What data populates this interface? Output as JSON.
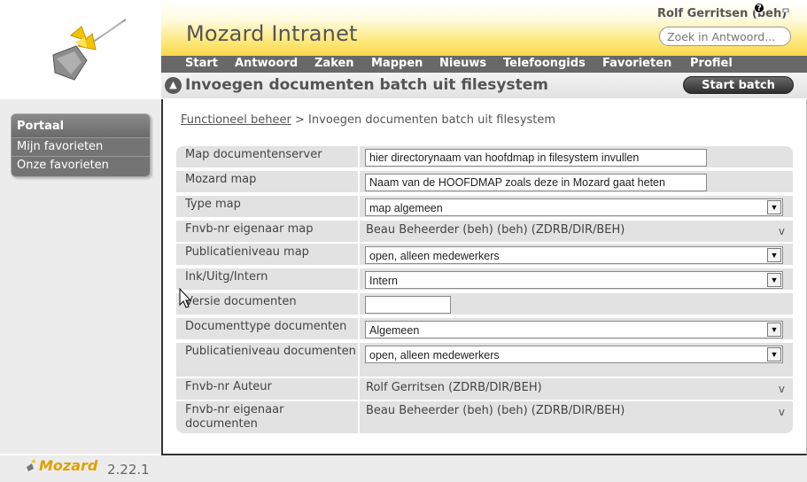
{
  "header": {
    "app_title": "Mozard Intranet",
    "user_name": "Rolf Gerritsen (beh)",
    "search_placeholder": "Zoek in Antwoord..."
  },
  "nav": {
    "items": [
      "Start",
      "Antwoord",
      "Zaken",
      "Mappen",
      "Nieuws",
      "Telefoongids",
      "Favorieten",
      "Profiel"
    ],
    "icons": [
      "help-icon",
      "print-icon"
    ]
  },
  "page": {
    "heading": "Invoegen documenten batch uit filesystem",
    "start_button": "Start batch",
    "breadcrumb_link": "Functioneel beheer",
    "breadcrumb_sep": " > ",
    "breadcrumb_current": "Invoegen documenten batch uit filesystem"
  },
  "sidebar": {
    "title": "Portaal",
    "items": [
      "Mijn favorieten",
      "Onze favorieten"
    ]
  },
  "form": {
    "rows": [
      {
        "label": "Map documentenserver",
        "type": "text",
        "value": "hier directorynaam van hoofdmap in filesystem invullen"
      },
      {
        "label": "Mozard map",
        "type": "text",
        "value": "Naam van de HOOFDMAP zoals deze in Mozard gaat heten"
      },
      {
        "label": "Type map",
        "type": "select",
        "value": "map algemeen"
      },
      {
        "label": "Fnvb-nr eigenaar map",
        "type": "static",
        "value": "Beau Beheerder (beh) (beh) (ZDRB/DIR/BEH)",
        "toggle": "v"
      },
      {
        "label": "Publicatieniveau map",
        "type": "select",
        "value": "open, alleen medewerkers"
      },
      {
        "label": "Ink/Uitg/Intern",
        "type": "select",
        "value": "Intern"
      },
      {
        "label": "Versie documenten",
        "type": "text",
        "value": ""
      },
      {
        "label": "Documenttype documenten",
        "type": "select",
        "value": "Algemeen"
      },
      {
        "label": "Publicatieniveau documenten",
        "type": "select",
        "value": "open, alleen medewerkers"
      },
      {
        "label": "Fnvb-nr Auteur",
        "type": "static",
        "value": "Rolf Gerritsen (ZDRB/DIR/BEH)",
        "toggle": "v"
      },
      {
        "label": "Fnvb-nr eigenaar documenten",
        "type": "static",
        "value": "Beau Beheerder (beh) (beh) (ZDRB/DIR/BEH)",
        "toggle": "v"
      }
    ]
  },
  "footer": {
    "logo_text": "Mozard",
    "version": "2.22.1"
  },
  "colors": {
    "header_yellow": "#f8d84a",
    "nav_gray": "#686868",
    "row_gray": "#e2e2e2"
  }
}
